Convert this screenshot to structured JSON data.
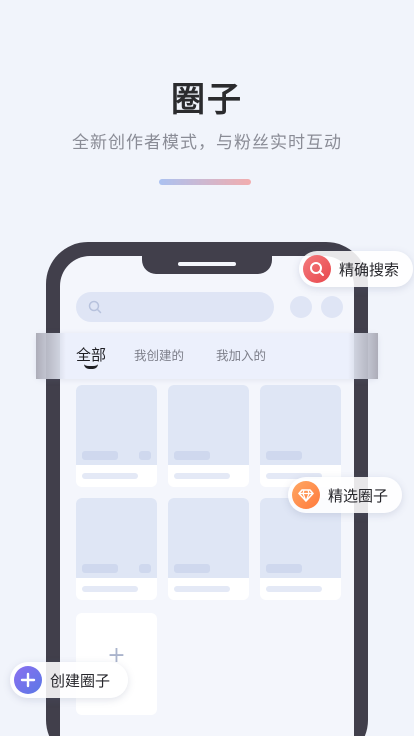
{
  "header": {
    "title": "圈子",
    "subtitle": "全新创作者模式，与粉丝实时互动"
  },
  "tabs": [
    {
      "label": "全部",
      "active": true
    },
    {
      "label": "我创建的",
      "active": false
    },
    {
      "label": "我加入的",
      "active": false
    }
  ],
  "badges": {
    "search": {
      "label": "精确搜索",
      "icon": "search-icon",
      "color": "#ef5a5e"
    },
    "featured": {
      "label": "精选圈子",
      "icon": "diamond-icon",
      "color": "#ff8a4c"
    },
    "create": {
      "label": "创建圈子",
      "icon": "plus-icon",
      "color": "#6b6fe8"
    }
  },
  "add_card": {
    "symbol": "+"
  },
  "colors": {
    "background": "#f1f4fb",
    "phone_frame": "#413f4b",
    "placeholder": "#dfe6f5"
  }
}
